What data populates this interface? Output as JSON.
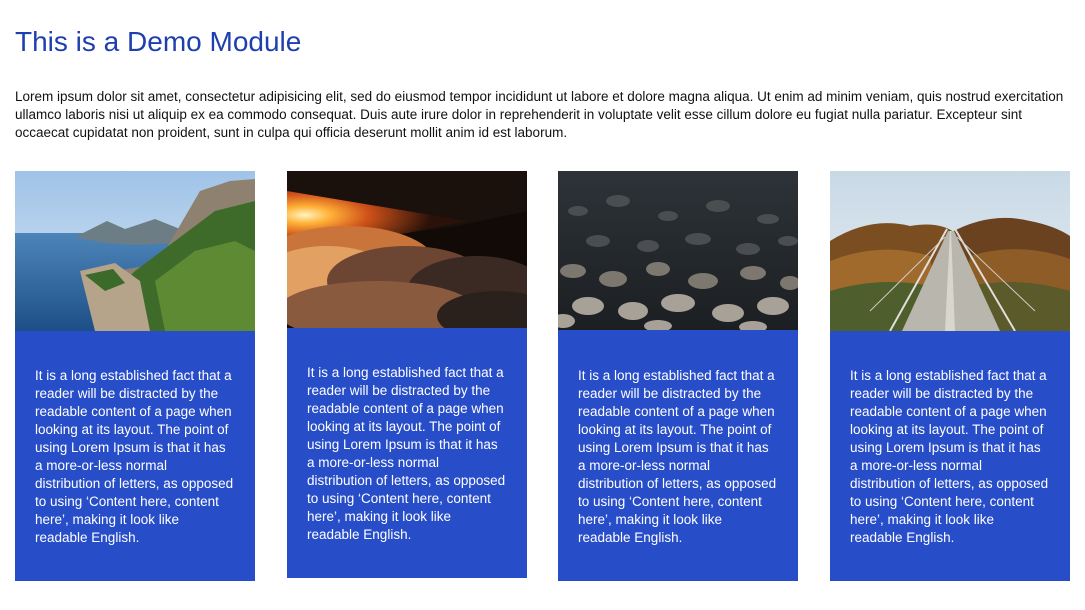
{
  "module": {
    "title": "This is a Demo Module",
    "intro": "Lorem ipsum dolor sit amet, consectetur adipisicing elit, sed do eiusmod tempor incididunt ut labore et dolore magna aliqua. Ut enim ad minim veniam, quis nostrud exercitation ullamco laboris nisi ut aliquip ex ea commodo consequat. Duis aute irure dolor in reprehenderit in voluptate velit esse cillum dolore eu fugiat nulla pariatur. Excepteur sint occaecat cupidatat non proident, sunt in culpa qui officia deserunt mollit anim id est laborum."
  },
  "colors": {
    "title": "#1f3fae",
    "card_background": "#274dc8",
    "card_text": "#ffffff"
  },
  "cards": [
    {
      "image": "coastal-cliff-photo",
      "text": "It is a long established fact that a reader will be distracted by the readable content of a page when looking at its layout. The point of using Lorem Ipsum is that it has a more-or-less normal distribution of letters, as opposed to using ‘Content here, content here’, making it look like readable English."
    },
    {
      "image": "sunset-clouds-photo",
      "text": "It is a long established fact that a reader will be distracted by the readable content of a page when looking at its layout. The point of using Lorem Ipsum is that it has a more-or-less normal distribution of letters, as opposed to using ‘Content here, content here’, making it look like readable English."
    },
    {
      "image": "river-stones-photo",
      "text": "It is a long established fact that a reader will be distracted by the readable content of a page when looking at its layout. The point of using Lorem Ipsum is that it has a more-or-less normal distribution of letters, as opposed to using ‘Content here, content here’, making it look like readable English."
    },
    {
      "image": "suspension-bridge-photo",
      "text": "It is a long established fact that a reader will be distracted by the readable content of a page when looking at its layout. The point of using Lorem Ipsum is that it has a more-or-less normal distribution of letters, as opposed to using ‘Content here, content here’, making it look like readable English."
    }
  ]
}
